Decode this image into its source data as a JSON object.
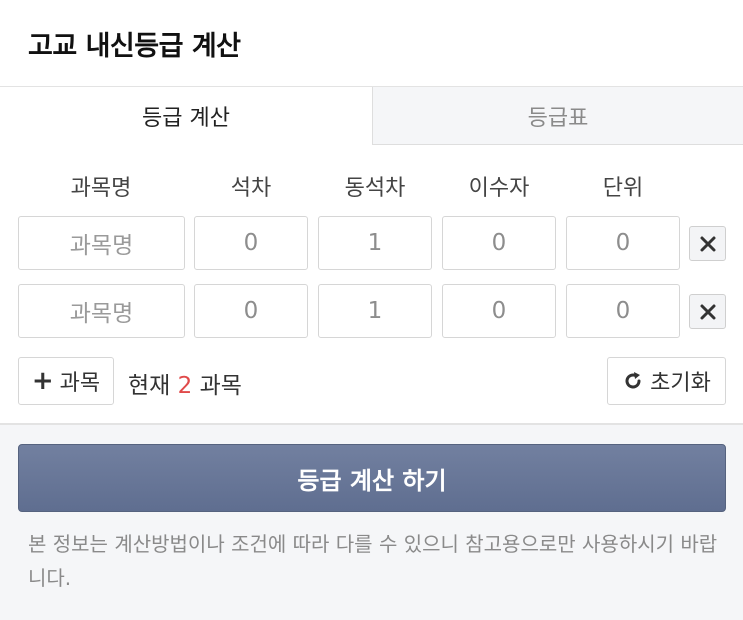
{
  "header": {
    "title": "고교 내신등급 계산"
  },
  "tabs": [
    {
      "label": "등급 계산",
      "active": true
    },
    {
      "label": "등급표",
      "active": false
    }
  ],
  "columns": [
    "과목명",
    "석차",
    "동석차",
    "이수자",
    "단위"
  ],
  "rows": [
    {
      "name_placeholder": "과목명",
      "rank": "0",
      "tie_rank": "1",
      "students": "0",
      "units": "0"
    },
    {
      "name_placeholder": "과목명",
      "rank": "0",
      "tie_rank": "1",
      "students": "0",
      "units": "0"
    }
  ],
  "controls": {
    "add_label": "과목",
    "add_icon": "plus-icon",
    "count_prefix": "현재",
    "count_value": "2",
    "count_suffix": "과목",
    "reset_label": "초기화",
    "reset_icon": "refresh-icon",
    "delete_icon": "close-icon"
  },
  "calculate": {
    "label": "등급 계산 하기"
  },
  "notice": "본 정보는 계산방법이나 조건에 따라 다를 수 있으니 참고용으로만 사용하시기 바랍니다.",
  "colors": {
    "accent_button": "#6a7898",
    "count_highlight": "#e04a4a",
    "inactive_tab_bg": "#f5f6f8"
  }
}
